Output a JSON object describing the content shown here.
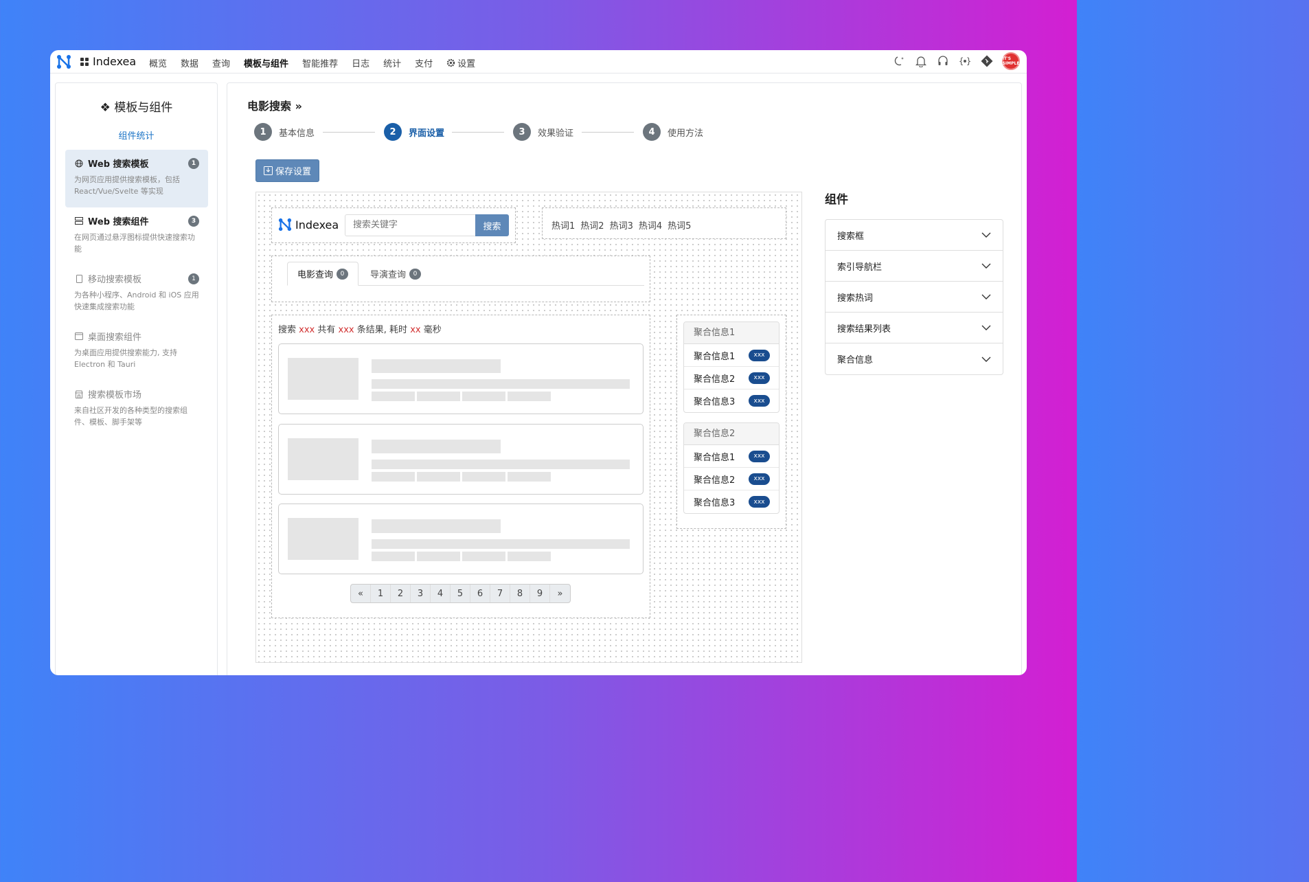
{
  "app": {
    "name": "Indexea"
  },
  "nav": {
    "items": [
      "概览",
      "数据",
      "查询",
      "模板与组件",
      "智能推荐",
      "日志",
      "统计",
      "支付"
    ],
    "active": "模板与组件",
    "settings": "设置"
  },
  "toolbar": {
    "icons": [
      "moon-icon",
      "bell-icon",
      "headset-icon",
      "api-icon",
      "git-icon"
    ],
    "avatar_text": "IT'S SIMPLE"
  },
  "sidebar": {
    "title": "模板与组件",
    "stats_link": "组件统计",
    "items": [
      {
        "icon": "globe-icon",
        "title": "Web 搜索模板",
        "badge": "1",
        "desc": "为网页应用提供搜索模板，包括 React/Vue/Svelte 等实现"
      },
      {
        "icon": "server-icon",
        "title": "Web 搜索组件",
        "badge": "3",
        "desc": "在网页通过悬浮图标提供快速搜索功能"
      },
      {
        "icon": "phone-icon",
        "title": "移动搜索模板",
        "badge": "1",
        "desc": "为各种小程序、Android 和 iOS 应用快速集成搜索功能"
      },
      {
        "icon": "window-icon",
        "title": "桌面搜索组件",
        "badge": "",
        "desc": "为桌面应用提供搜索能力, 支持 Electron 和 Tauri"
      },
      {
        "icon": "shop-icon",
        "title": "搜索模板市场",
        "badge": "",
        "desc": "来自社区开发的各种类型的搜索组件、模板、脚手架等"
      }
    ]
  },
  "main": {
    "breadcrumb": "电影搜索 »",
    "steps": [
      {
        "num": "1",
        "label": "基本信息"
      },
      {
        "num": "2",
        "label": "界面设置"
      },
      {
        "num": "3",
        "label": "效果验证"
      },
      {
        "num": "4",
        "label": "使用方法"
      }
    ],
    "current_step": 2,
    "save_label": "保存设置"
  },
  "preview": {
    "brand": "Indexea",
    "search_placeholder": "搜索关键字",
    "search_button": "搜索",
    "hot_words": [
      "热词1",
      "热词2",
      "热词3",
      "热词4",
      "热词5"
    ],
    "tabs": [
      {
        "label": "电影查询",
        "count": "0"
      },
      {
        "label": "导演查询",
        "count": "0"
      }
    ],
    "result_info": {
      "prefix": "搜索",
      "q": "xxx",
      "mid1": "共有",
      "n": "xxx",
      "mid2": "条结果, 耗时",
      "t": "xx",
      "suffix": "毫秒"
    },
    "pagination": [
      "«",
      "1",
      "2",
      "3",
      "4",
      "5",
      "6",
      "7",
      "8",
      "9",
      "»"
    ],
    "aggregations": [
      {
        "title": "聚合信息1",
        "items": [
          {
            "label": "聚合信息1",
            "value": "xxx"
          },
          {
            "label": "聚合信息2",
            "value": "xxx"
          },
          {
            "label": "聚合信息3",
            "value": "xxx"
          }
        ]
      },
      {
        "title": "聚合信息2",
        "items": [
          {
            "label": "聚合信息1",
            "value": "xxx"
          },
          {
            "label": "聚合信息2",
            "value": "xxx"
          },
          {
            "label": "聚合信息3",
            "value": "xxx"
          }
        ]
      }
    ]
  },
  "components": {
    "title": "组件",
    "items": [
      "搜索框",
      "索引导航栏",
      "搜索热词",
      "搜索结果列表",
      "聚合信息"
    ]
  },
  "colors": {
    "primary": "#1a5fa8",
    "button": "#5e88b8",
    "highlight": "#d12f2f"
  }
}
